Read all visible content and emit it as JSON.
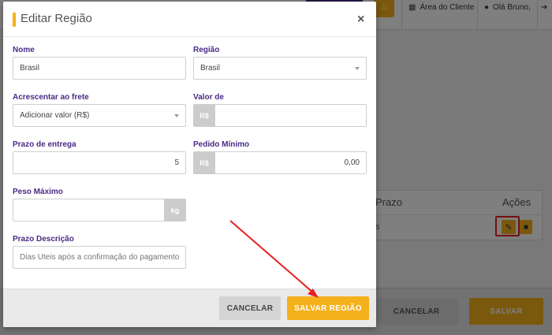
{
  "background": {
    "topbar": {
      "bell_icon": "bell-icon",
      "client_area_icon": "id-card-icon",
      "client_area_label": "Área do Cliente",
      "user_icon": "user-icon",
      "user_greeting": "Olá Bruno,",
      "logout_icon": "sign-out-icon"
    },
    "table": {
      "headers": [
        "Prazo",
        "Ações"
      ],
      "row_mark": "s",
      "edit_icon": "pencil-icon",
      "delete_icon": "trash-icon"
    },
    "footer": {
      "cancel_label": "CANCELAR",
      "save_label": "SALVAR"
    }
  },
  "modal": {
    "title": "Editar Região",
    "close_label": "×",
    "fields": {
      "nome": {
        "label": "Nome",
        "value": "Brasil"
      },
      "regiao": {
        "label": "Região",
        "value": "Brasil"
      },
      "acrescentar": {
        "label": "Acrescentar ao frete",
        "value": "Adicionar valor (R$)"
      },
      "valor_de": {
        "label": "Valor de",
        "prefix": "R$",
        "value": ""
      },
      "prazo_entrega": {
        "label": "Prazo de entrega",
        "value": "5"
      },
      "pedido_minimo": {
        "label": "Pedido Mínimo",
        "prefix": "R$",
        "value": "0,00"
      },
      "peso_maximo": {
        "label": "Peso Máximo",
        "suffix": "kg",
        "value": ""
      },
      "prazo_descricao": {
        "label": "Prazo Descrição",
        "placeholder": "Dias Úteis após a confirmação do pagamento"
      }
    },
    "buttons": {
      "cancel_label": "CANCELAR",
      "save_label": "SALVAR REGIÃO"
    }
  },
  "colors": {
    "accent": "#f5b11c",
    "label": "#4a2a85",
    "annotation": "#e5201f"
  }
}
